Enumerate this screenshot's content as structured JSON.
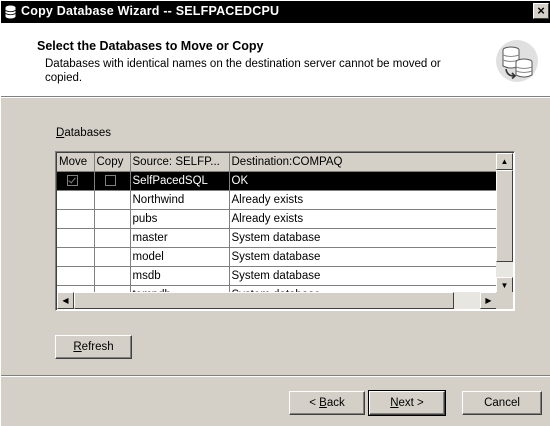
{
  "window": {
    "title": "Copy Database Wizard  -- SELFPACEDCPU",
    "close_glyph": "×"
  },
  "header": {
    "title": "Select the Databases to Move or Copy",
    "subtitle": "Databases with identical names on the destination server cannot be moved or copied."
  },
  "databases_label": {
    "accel": "D",
    "rest": "atabases"
  },
  "grid": {
    "columns": [
      "Move",
      "Copy",
      "Source: SELFP...",
      "Destination:COMPAQ"
    ],
    "rows": [
      {
        "move": true,
        "copy": false,
        "source": "SelfPacedSQL",
        "destination": "OK",
        "selected": true
      },
      {
        "move": false,
        "copy": false,
        "source": "Northwind",
        "destination": "Already exists",
        "selected": false
      },
      {
        "move": false,
        "copy": false,
        "source": "pubs",
        "destination": "Already exists",
        "selected": false
      },
      {
        "move": false,
        "copy": false,
        "source": "master",
        "destination": "System database",
        "selected": false
      },
      {
        "move": false,
        "copy": false,
        "source": "model",
        "destination": "System database",
        "selected": false
      },
      {
        "move": false,
        "copy": false,
        "source": "msdb",
        "destination": "System database",
        "selected": false
      },
      {
        "move": false,
        "copy": false,
        "source": "tempdb",
        "destination": "System database",
        "selected": false
      }
    ],
    "scroll_up": "▲",
    "scroll_down": "▼",
    "scroll_left": "◀",
    "scroll_right": "▶"
  },
  "buttons": {
    "refresh": {
      "accel": "R",
      "rest": "efresh"
    },
    "back": {
      "pre": "< ",
      "accel": "B",
      "rest": "ack"
    },
    "next": {
      "accel": "N",
      "rest": "ext >"
    },
    "cancel": "Cancel"
  }
}
